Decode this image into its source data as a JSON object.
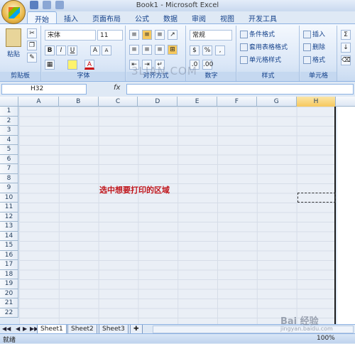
{
  "window": {
    "title": "Book1 - Microsoft Excel"
  },
  "tabs": [
    "开始",
    "插入",
    "页面布局",
    "公式",
    "数据",
    "审阅",
    "视图",
    "开发工具"
  ],
  "ribbon": {
    "clipboard": {
      "paste": "粘贴",
      "label": "剪贴板"
    },
    "font": {
      "name": "宋体",
      "size": "11",
      "label": "字体",
      "bold": "B",
      "italic": "I",
      "underline": "U",
      "grow": "A",
      "shrink": "A",
      "fontcolor": "A"
    },
    "alignment": {
      "label": "对齐方式"
    },
    "number": {
      "format": "常规",
      "label": "数字",
      "percent": "%",
      "comma": ","
    },
    "styles": {
      "conditional": "条件格式",
      "table": "套用表格格式",
      "cell": "单元格样式",
      "label": "样式"
    },
    "cells": {
      "insert": "插入",
      "delete": "删除",
      "format": "格式",
      "label": "单元格"
    }
  },
  "formula": {
    "namebox": "H32",
    "fx": "fx"
  },
  "columns": [
    "A",
    "B",
    "C",
    "D",
    "E",
    "F",
    "G",
    "H"
  ],
  "rows": [
    "1",
    "2",
    "3",
    "4",
    "5",
    "6",
    "7",
    "8",
    "9",
    "10",
    "11",
    "12",
    "13",
    "14",
    "15",
    "16",
    "17",
    "18",
    "19",
    "20",
    "21",
    "22"
  ],
  "annotation": "选中想要打印的区域",
  "sheets": [
    "Sheet1",
    "Sheet2",
    "Sheet3"
  ],
  "status": {
    "ready": "就绪",
    "zoom": "100%"
  },
  "watermark": {
    "main": "3LIAN.COM",
    "baidu": "Bai 经验",
    "url": "jingyan.baidu.com"
  }
}
